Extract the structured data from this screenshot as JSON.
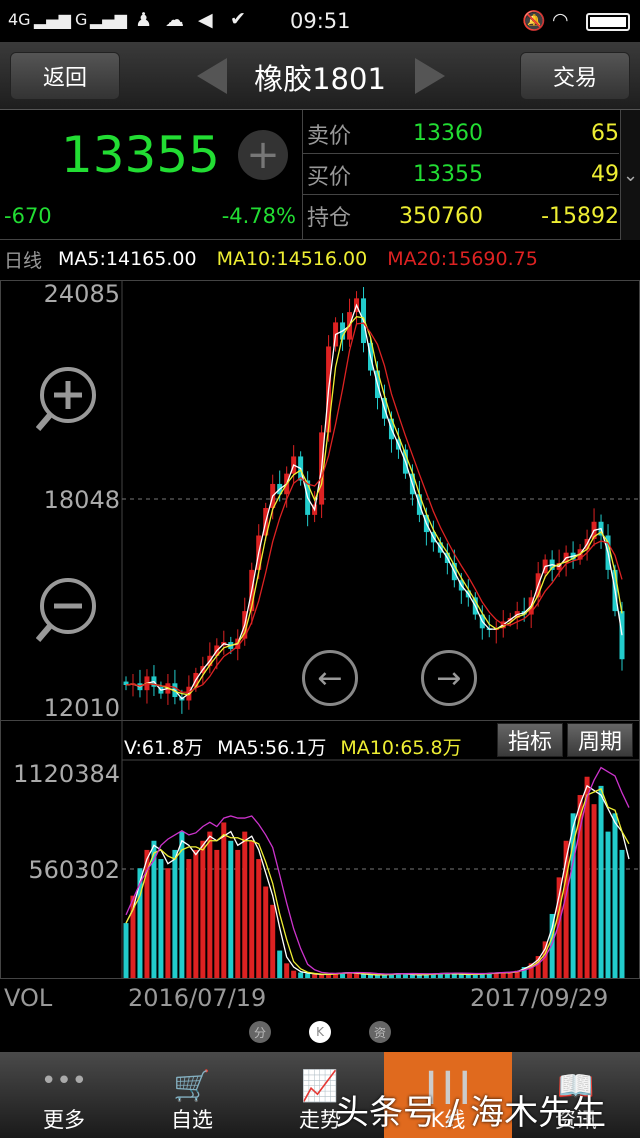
{
  "status_bar": {
    "network1": "4G",
    "network2": "G",
    "time": "09:51",
    "icons": [
      "signal-icon",
      "qq-icon",
      "wechat-icon",
      "mute-icon",
      "check-icon",
      "alarm-off-icon",
      "wifi-icon",
      "battery-icon"
    ]
  },
  "header": {
    "back": "返回",
    "title": "橡胶1801",
    "trade": "交易"
  },
  "quote": {
    "price": "13355",
    "change": "-670",
    "change_pct": "-4.78%",
    "rows": [
      {
        "label": "卖价",
        "price": "13360",
        "qty": "65"
      },
      {
        "label": "买价",
        "price": "13355",
        "qty": "49"
      },
      {
        "label": "持仓",
        "price": "350760",
        "qty": "-15892"
      }
    ]
  },
  "ma": {
    "period": "日线",
    "ma5": "MA5:14165.00",
    "ma10": "MA10:14516.00",
    "ma20": "MA20:15690.75"
  },
  "colors": {
    "up": "#dd2222",
    "down": "#22cccc",
    "ma5": "#ffffff",
    "ma10": "#eeee33",
    "ma20": "#dd2222",
    "vol_long": "#cc33cc",
    "active_tab": "#e06a1e"
  },
  "vol_header": {
    "v": "V:61.8万",
    "ma5": "MA5:56.1万",
    "ma10": "MA10:65.8万",
    "indicator_btn": "指标",
    "period_btn": "周期"
  },
  "chart_data": [
    {
      "type": "candlestick",
      "title": "",
      "ylim": [
        12010,
        24085
      ],
      "y_ticks": [
        "24085",
        "18048",
        "12010"
      ],
      "x_labels": [
        "2016/07/19",
        "2017/09/29"
      ],
      "closes": [
        12650,
        12700,
        12500,
        12900,
        12600,
        12400,
        12700,
        12300,
        12200,
        12600,
        13000,
        13200,
        13500,
        13800,
        13900,
        13700,
        14000,
        14800,
        16000,
        17000,
        17800,
        18500,
        18200,
        18800,
        19300,
        18600,
        17600,
        17900,
        20000,
        22500,
        23200,
        22700,
        23500,
        23900,
        22600,
        21800,
        21000,
        20400,
        19800,
        19500,
        18800,
        18200,
        17600,
        17100,
        16800,
        16500,
        16200,
        15700,
        15400,
        15200,
        14700,
        14300,
        14250,
        14300,
        14500,
        14600,
        14800,
        14700,
        15200,
        15900,
        16300,
        16000,
        16200,
        16500,
        16300,
        16600,
        16900,
        17400,
        17000,
        16000,
        14800,
        13400
      ]
    },
    {
      "type": "bar",
      "label": "VOL",
      "ylim": [
        0,
        1120384
      ],
      "y_ticks": [
        "1120384",
        "560302"
      ],
      "values": [
        300000,
        450000,
        600000,
        700000,
        750000,
        650000,
        600000,
        700000,
        800000,
        650000,
        700000,
        750000,
        800000,
        700000,
        850000,
        750000,
        700000,
        800000,
        750000,
        650000,
        500000,
        400000,
        150000,
        80000,
        40000,
        30000,
        25000,
        20000,
        18000,
        22000,
        25000,
        30000,
        28000,
        24000,
        20000,
        18000,
        16000,
        19000,
        22000,
        25000,
        21000,
        18000,
        17000,
        20000,
        23000,
        26000,
        24000,
        22000,
        20000,
        19000,
        21000,
        24000,
        26000,
        28000,
        30000,
        30000,
        40000,
        60000,
        80000,
        120000,
        200000,
        350000,
        550000,
        750000,
        900000,
        1000000,
        1100000,
        950000,
        1050000,
        800000,
        900000,
        700000,
        600000
      ]
    }
  ],
  "page_dots": [
    "分",
    "K",
    "资"
  ],
  "nav": [
    {
      "label": "更多",
      "icon": "more-icon"
    },
    {
      "label": "自选",
      "icon": "cart-icon"
    },
    {
      "label": "走势",
      "icon": "trend-icon"
    },
    {
      "label": "K线",
      "icon": "candlestick-icon"
    },
    {
      "label": "资讯",
      "icon": "book-icon"
    }
  ],
  "watermark": "头条号 / 海木先生"
}
